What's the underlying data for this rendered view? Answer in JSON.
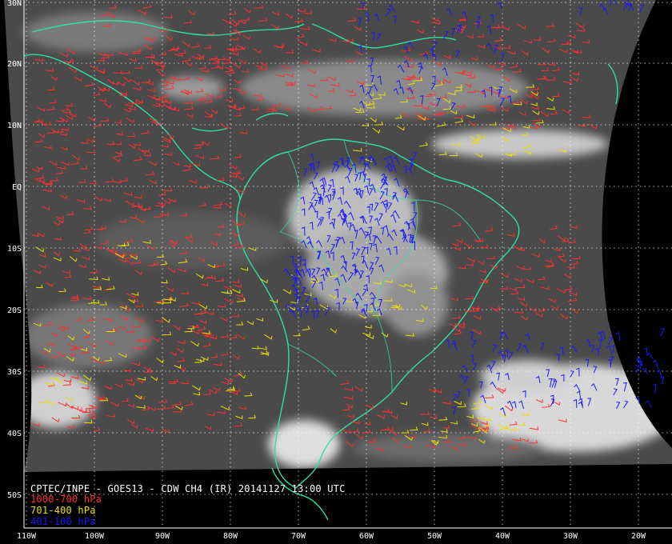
{
  "title": "CPTEC/INPE - GOES13 - CDW CH4 (IR) 20141127 13:00 UTC",
  "legend": [
    {
      "label": "1000-700 hPa",
      "color": "#ff3030"
    },
    {
      "label": "701-400 hPa",
      "color": "#e8e000"
    },
    {
      "label": "401-100 hPa",
      "color": "#1818ff"
    }
  ],
  "lat_labels": [
    "30N",
    "20N",
    "10N",
    "EQ",
    "10S",
    "20S",
    "30S",
    "40S",
    "50S"
  ],
  "lon_labels": [
    "110W",
    "100W",
    "90W",
    "80W",
    "70W",
    "60W",
    "50W",
    "40W",
    "30W",
    "20W"
  ],
  "colors": {
    "background": "#000000",
    "coastline": "#30e0a0",
    "grid": "#ffffff",
    "cloud_dark": "#4a4a4a",
    "cloud_light": "#dcdcdc"
  }
}
